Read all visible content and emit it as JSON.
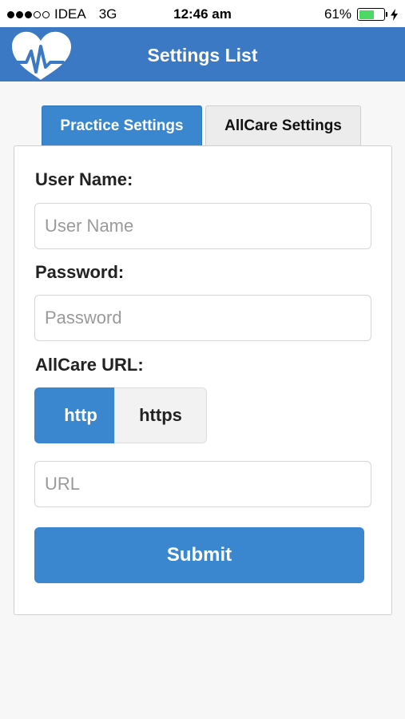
{
  "status_bar": {
    "carrier": "IDEA",
    "network": "3G",
    "time": "12:46 am",
    "battery_percent": "61%",
    "battery_level": 0.61,
    "signal_bars": 3,
    "signal_max": 5
  },
  "header": {
    "title": "Settings List",
    "logo_icon": "heart-pulse-icon",
    "color": "#3b79c4"
  },
  "tabs": [
    {
      "label": "Practice Settings",
      "active": true
    },
    {
      "label": "AllCare Settings",
      "active": false
    }
  ],
  "form": {
    "username_label": "User Name:",
    "username_placeholder": "User Name",
    "password_label": "Password:",
    "password_placeholder": "Password",
    "url_label": "AllCare URL:",
    "protocol_options": [
      "http",
      "https"
    ],
    "protocol_selected": "http",
    "url_placeholder": "URL",
    "submit_label": "Submit"
  },
  "colors": {
    "accent": "#3a87cf",
    "battery": "#4cd964"
  }
}
